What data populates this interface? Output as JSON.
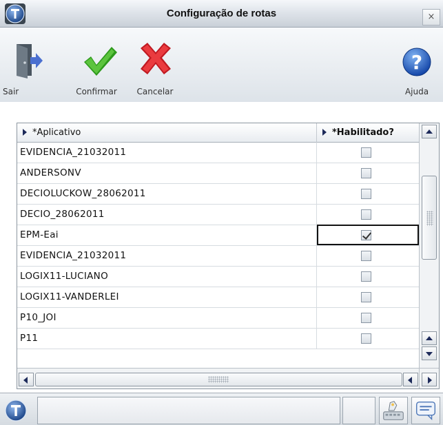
{
  "window": {
    "title": "Configuração de rotas",
    "close_label": "×"
  },
  "toolbar": {
    "exit_label": "Sair",
    "confirm_label": "Confirmar",
    "cancel_label": "Cancelar",
    "help_label": "Ajuda"
  },
  "grid": {
    "columns": {
      "app": "*Aplicativo",
      "enabled": "*Habilitado?"
    },
    "rows": [
      {
        "app": "EVIDENCIA_21032011",
        "enabled": false
      },
      {
        "app": "ANDERSONV",
        "enabled": false
      },
      {
        "app": "DECIOLUCKOW_28062011",
        "enabled": false
      },
      {
        "app": "DECIO_28062011",
        "enabled": false
      },
      {
        "app": "EPM-Eai",
        "enabled": true
      },
      {
        "app": "EVIDENCIA_21032011",
        "enabled": false
      },
      {
        "app": "LOGIX11-LUCIANO",
        "enabled": false
      },
      {
        "app": "LOGIX11-VANDERLEI",
        "enabled": false
      },
      {
        "app": "P10_JOI",
        "enabled": false
      },
      {
        "app": "P11",
        "enabled": false
      }
    ],
    "selected_row_index": 4
  },
  "icons": {
    "app_logo": "totvs-logo-icon",
    "exit": "door-exit-icon",
    "confirm": "green-check-icon",
    "cancel": "red-x-icon",
    "help": "help-question-icon",
    "keyboard": "keyboard-icon",
    "chat": "chat-bubble-icon"
  },
  "colors": {
    "confirm_green": "#2e9a1c",
    "cancel_red": "#d3212a",
    "help_blue": "#1f5fc0",
    "logo_blue": "#1d4f9a"
  }
}
